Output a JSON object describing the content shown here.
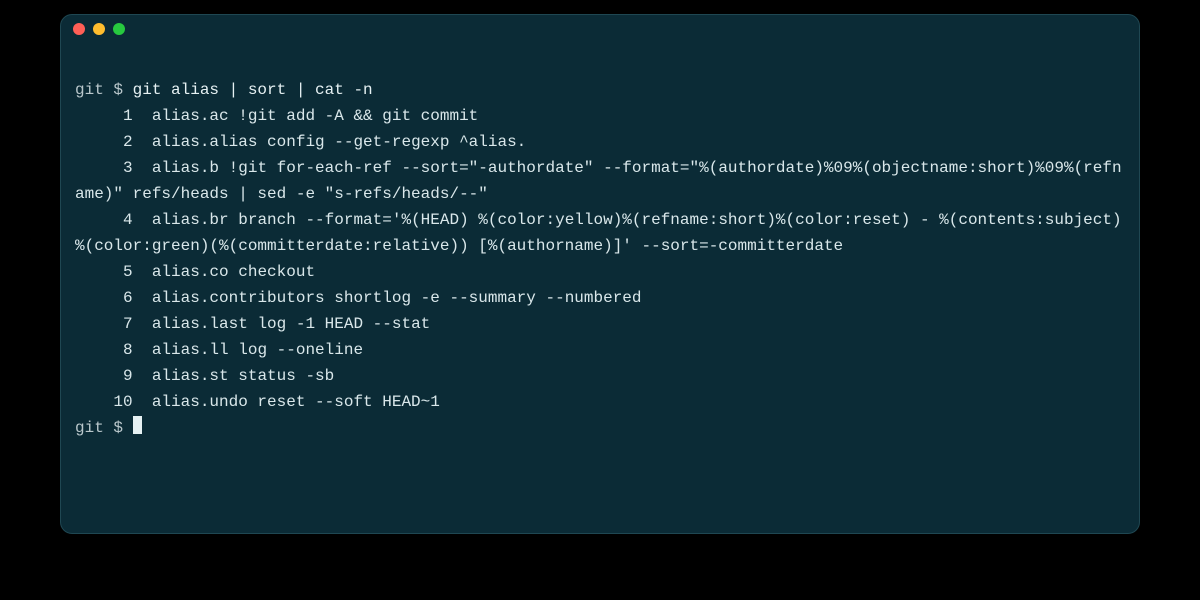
{
  "window": {
    "traffic_lights": [
      "close",
      "minimize",
      "zoom"
    ]
  },
  "colors": {
    "bg": "#0b2b36",
    "text": "#d9e7ea",
    "prompt": "#b9c7cb",
    "red": "#ff5f56",
    "yellow": "#ffbd2e",
    "green": "#27c93f"
  },
  "session": {
    "prompt": "git $ ",
    "command": "git alias | sort | cat -n",
    "lines": [
      {
        "n": 1,
        "text": "alias.ac !git add -A && git commit"
      },
      {
        "n": 2,
        "text": "alias.alias config --get-regexp ^alias."
      },
      {
        "n": 3,
        "text": "alias.b !git for-each-ref --sort=\"-authordate\" --format=\"%(authordate)%09%(objectname:short)%09%(refname)\" refs/heads | sed -e \"s-refs/heads/--\""
      },
      {
        "n": 4,
        "text": "alias.br branch --format='%(HEAD) %(color:yellow)%(refname:short)%(color:reset) - %(contents:subject) %(color:green)(%(committerdate:relative)) [%(authorname)]' --sort=-committerdate"
      },
      {
        "n": 5,
        "text": "alias.co checkout"
      },
      {
        "n": 6,
        "text": "alias.contributors shortlog -e --summary --numbered"
      },
      {
        "n": 7,
        "text": "alias.last log -1 HEAD --stat"
      },
      {
        "n": 8,
        "text": "alias.ll log --oneline"
      },
      {
        "n": 9,
        "text": "alias.st status -sb"
      },
      {
        "n": 10,
        "text": "alias.undo reset --soft HEAD~1"
      }
    ],
    "trailing_prompt": "git $ "
  }
}
